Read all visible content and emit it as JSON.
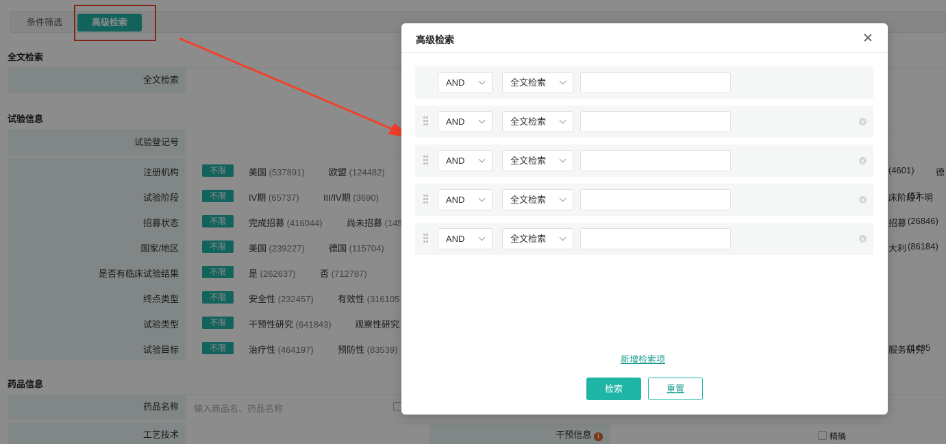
{
  "tabs": {
    "filter": "条件筛选",
    "advanced": "高级检索"
  },
  "sections": {
    "fulltext": {
      "title": "全文检索",
      "label": "全文检索"
    },
    "trial": {
      "title": "试验信息",
      "reg_label": "试验登记号",
      "unlimited": "不限",
      "rows": [
        {
          "label": "注册机构",
          "opts": [
            {
              "name": "美国",
              "count": "(537891)"
            },
            {
              "name": "欧盟",
              "count": "(124482)"
            }
          ],
          "right": [
            {
              "text": "(4601)"
            },
            {
              "text": "德"
            }
          ]
        },
        {
          "label": "试验阶段",
          "opts": [
            {
              "name": "IV期",
              "count": "(65737)"
            },
            {
              "name": "III/IV期",
              "count": "(3690)"
            }
          ],
          "right": [
            {
              "text": "床阶段不明"
            },
            {
              "text": "(57"
            }
          ]
        },
        {
          "label": "招募状态",
          "opts": [
            {
              "name": "完成招募",
              "count": "(416044)"
            },
            {
              "name": "尚未招募",
              "count": "(145"
            }
          ],
          "right": [
            {
              "text": "招募"
            },
            {
              "text": "(26846)"
            }
          ]
        },
        {
          "label": "国家/地区",
          "opts": [
            {
              "name": "美国",
              "count": "(239227)"
            },
            {
              "name": "德国",
              "count": "(115704)"
            }
          ],
          "right": [
            {
              "text": "大利"
            },
            {
              "text": "(86184)"
            }
          ]
        },
        {
          "label": "是否有临床试验结果",
          "opts": [
            {
              "name": "是",
              "count": "(262637)"
            },
            {
              "name": "否",
              "count": "(712787)"
            }
          ],
          "right": []
        },
        {
          "label": "终点类型",
          "opts": [
            {
              "name": "安全性",
              "count": "(232457)"
            },
            {
              "name": "有效性",
              "count": "(316105"
            }
          ],
          "right": []
        },
        {
          "label": "试验类型",
          "opts": [
            {
              "name": "干预性研究",
              "count": "(641843)"
            },
            {
              "name": "观察性研究",
              "count": ""
            }
          ],
          "right": []
        },
        {
          "label": "试验目标",
          "opts": [
            {
              "name": "治疗性",
              "count": "(464197)"
            },
            {
              "name": "预防性",
              "count": "(83539)"
            }
          ],
          "right": [
            {
              "text": "服务研究"
            },
            {
              "text": "(1435"
            }
          ]
        }
      ]
    },
    "drug": {
      "title": "药品信息",
      "name_label": "药品名称",
      "name_placeholder": "输入商品名、药品名称",
      "process_label": "工艺技术",
      "intervention_label": "干预信息",
      "exact_label": "精确"
    }
  },
  "modal": {
    "title": "高级检索",
    "rows": [
      {
        "op": "AND",
        "field": "全文检索",
        "value": "",
        "removable": false
      },
      {
        "op": "AND",
        "field": "全文检索",
        "value": "",
        "removable": true
      },
      {
        "op": "AND",
        "field": "全文检索",
        "value": "",
        "removable": true
      },
      {
        "op": "AND",
        "field": "全文检索",
        "value": "",
        "removable": true
      },
      {
        "op": "AND",
        "field": "全文检索",
        "value": "",
        "removable": true
      }
    ],
    "add_label": "新增检索项",
    "search_label": "检索",
    "reset_label": "重置"
  },
  "colors": {
    "accent": "#1fb5a6",
    "annotation": "#f0412a"
  }
}
